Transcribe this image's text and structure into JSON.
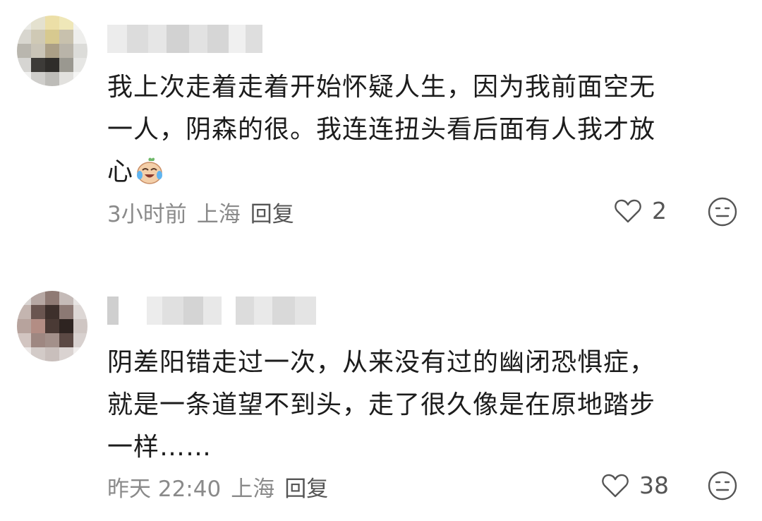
{
  "comments": [
    {
      "text_lines": [
        "我上次走着走着开始怀疑人生，因为我前面空无",
        "一人，阴森的很。我连连扭头看后面有人我才放",
        "心"
      ],
      "emoji": "crying-laughing-emoji",
      "time": "3小时前",
      "location": "上海",
      "reply_label": "回复",
      "like_count": "2"
    },
    {
      "text_lines": [
        "阴差阳错走过一次，从来没有过的幽闭恐惧症，",
        "就是一条道望不到头，走了很久像是在原地踏步",
        "一样……"
      ],
      "time": "昨天 22:40",
      "location": "上海",
      "reply_label": "回复",
      "like_count": "38"
    }
  ],
  "icons": {
    "like": "heart-outline-icon",
    "dislike": "neutral-face-icon"
  },
  "colors": {
    "text": "#1c1c1c",
    "meta": "#8a8a8a",
    "icon": "#555555"
  }
}
